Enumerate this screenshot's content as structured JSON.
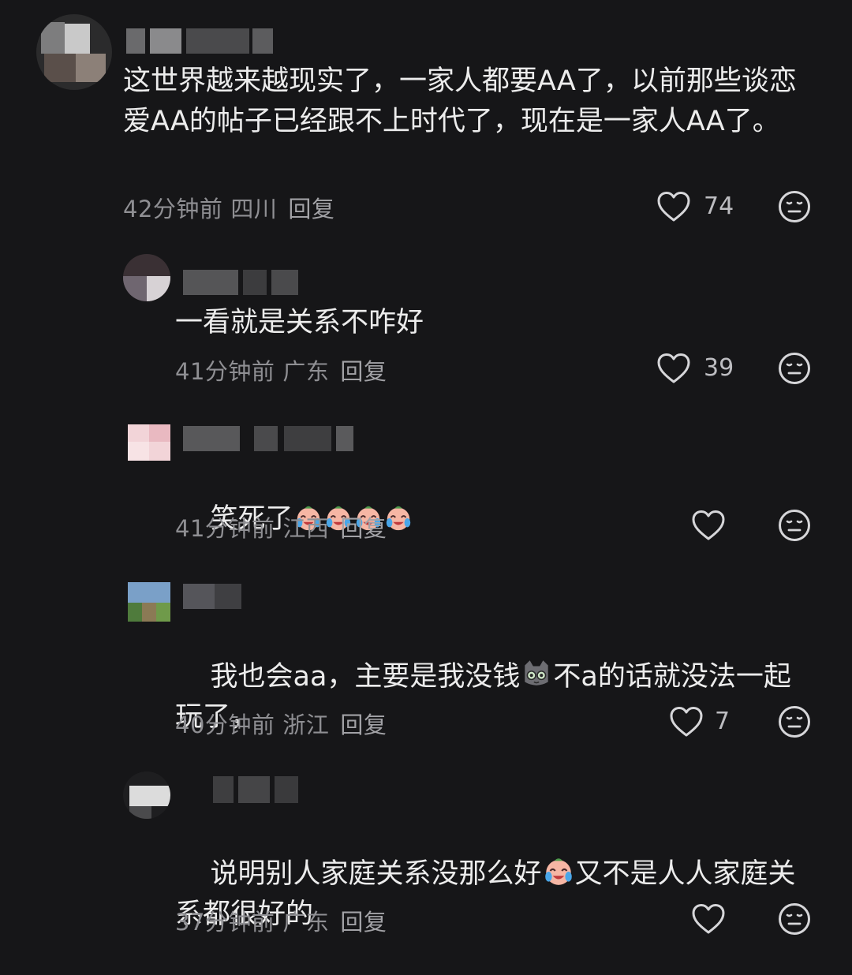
{
  "comments": [
    {
      "text": "这世界越来越现实了，一家人都要AA了，以前那些谈恋爱AA的帖子已经跟不上时代了，现在是一家人AA了。",
      "time": "42分钟前",
      "location": "四川",
      "reply": "回复",
      "likes": "74"
    },
    {
      "text": "一看就是关系不咋好",
      "time": "41分钟前",
      "location": "广东",
      "reply": "回复",
      "likes": "39"
    },
    {
      "text": "笑死了",
      "time": "41分钟前",
      "location": "江西",
      "reply": "回复",
      "likes": ""
    },
    {
      "text_a": "我也会aa，主要是我没钱",
      "text_b": "不a的话就没法一起",
      "text_c": "玩了，",
      "time": "40分钟前",
      "location": "浙江",
      "reply": "回复",
      "likes": "7"
    },
    {
      "text_a": "说明别人家庭关系没那么好",
      "text_b": "又不是人人家庭关",
      "text_c": "系都很好的",
      "time": "37分钟前",
      "location": "广东",
      "reply": "回复",
      "likes": ""
    }
  ],
  "icons": {
    "like": "heart-outline-icon",
    "dislike": "meh-face-icon",
    "laugh_cry": "laugh-cry-emoji",
    "cat": "cat-emoji"
  },
  "colors": {
    "background": "#161618",
    "text": "#ececec",
    "meta": "#8f8f93"
  }
}
